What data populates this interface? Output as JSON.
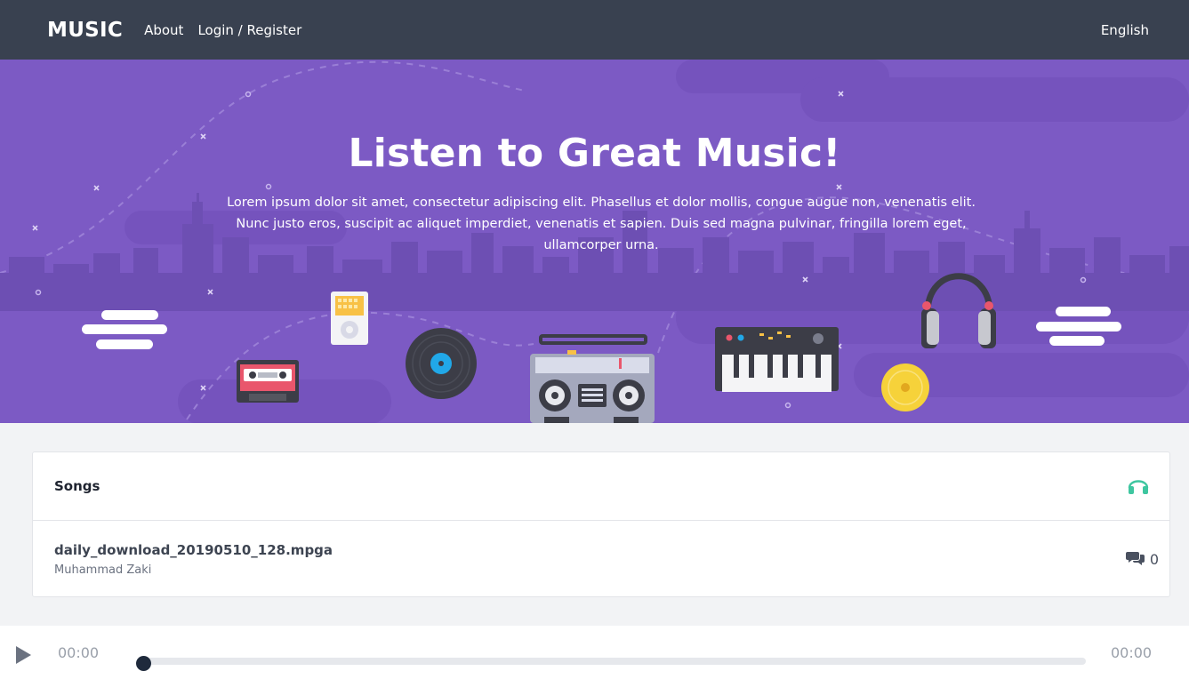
{
  "nav": {
    "brand": "MUSIC",
    "links": [
      "About",
      "Login / Register"
    ],
    "language": "English"
  },
  "hero": {
    "title": "Listen to Great Music!",
    "text": "Lorem ipsum dolor sit amet, consectetur adipiscing elit. Phasellus et dolor mollis, congue augue non, venenatis elit. Nunc justo eros, suscipit ac aliquet imperdiet, venenatis et sapien. Duis sed magna pulvinar, fringilla lorem eget, ullamcorper urna."
  },
  "songs": {
    "title": "Songs",
    "header_icon": "headphones-icon",
    "items": [
      {
        "name": "daily_download_20190510_128.mpga",
        "artist": "Muhammad Zaki",
        "comments": "0",
        "comment_icon": "comments-icon"
      }
    ]
  },
  "player": {
    "current_time": "00:00",
    "duration": "00:00",
    "progress": 0
  },
  "colors": {
    "navbar": "#394150",
    "hero": "#7c5ac4",
    "accent": "#3ec6a0",
    "background": "#f2f3f5"
  }
}
